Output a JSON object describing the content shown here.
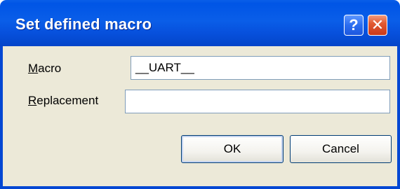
{
  "dialog": {
    "title": "Set defined macro",
    "help_glyph": "?",
    "close_glyph": "✕"
  },
  "fields": {
    "macro_label_accel": "M",
    "macro_label_rest": "acro",
    "macro_value": "__UART__",
    "replacement_label_accel": "R",
    "replacement_label_rest": "eplacement",
    "replacement_value": ""
  },
  "buttons": {
    "ok_label": "OK",
    "cancel_label": "Cancel"
  },
  "colors": {
    "titlebar": "#0a5ee8",
    "frame": "#0347d3",
    "client_bg": "#ece9d8",
    "close_button": "#e25b33"
  },
  "icons": {
    "help": "help-icon",
    "close": "close-icon"
  }
}
